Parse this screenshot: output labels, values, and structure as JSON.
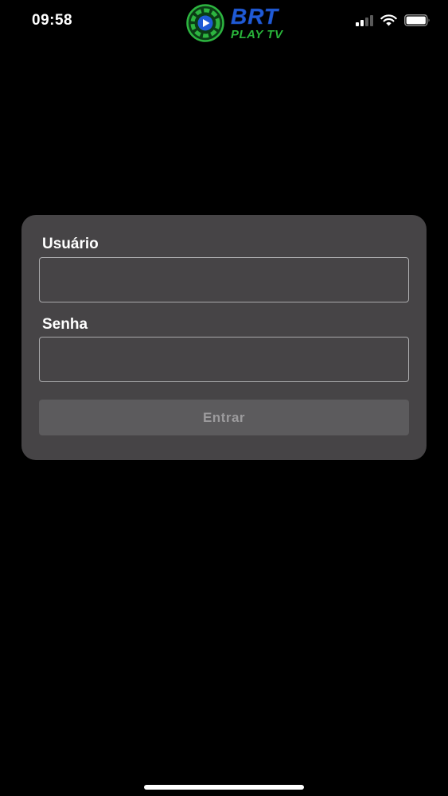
{
  "status_bar": {
    "time": "09:58",
    "icons": [
      "cellular-signal-icon",
      "wifi-icon",
      "battery-icon"
    ]
  },
  "logo": {
    "brand": "BRT",
    "sub": "PLAY TV",
    "colors": {
      "brand": "#1f5bd6",
      "sub": "#29b33a"
    }
  },
  "login_form": {
    "username_label": "Usuário",
    "username_value": "",
    "password_label": "Senha",
    "password_value": "",
    "submit_label": "Entrar"
  },
  "colors": {
    "background": "#000000",
    "card": "#464446",
    "input_border": "#a9a9ab",
    "button_bg": "#5c5b5d",
    "button_text": "#9c9b9d"
  }
}
